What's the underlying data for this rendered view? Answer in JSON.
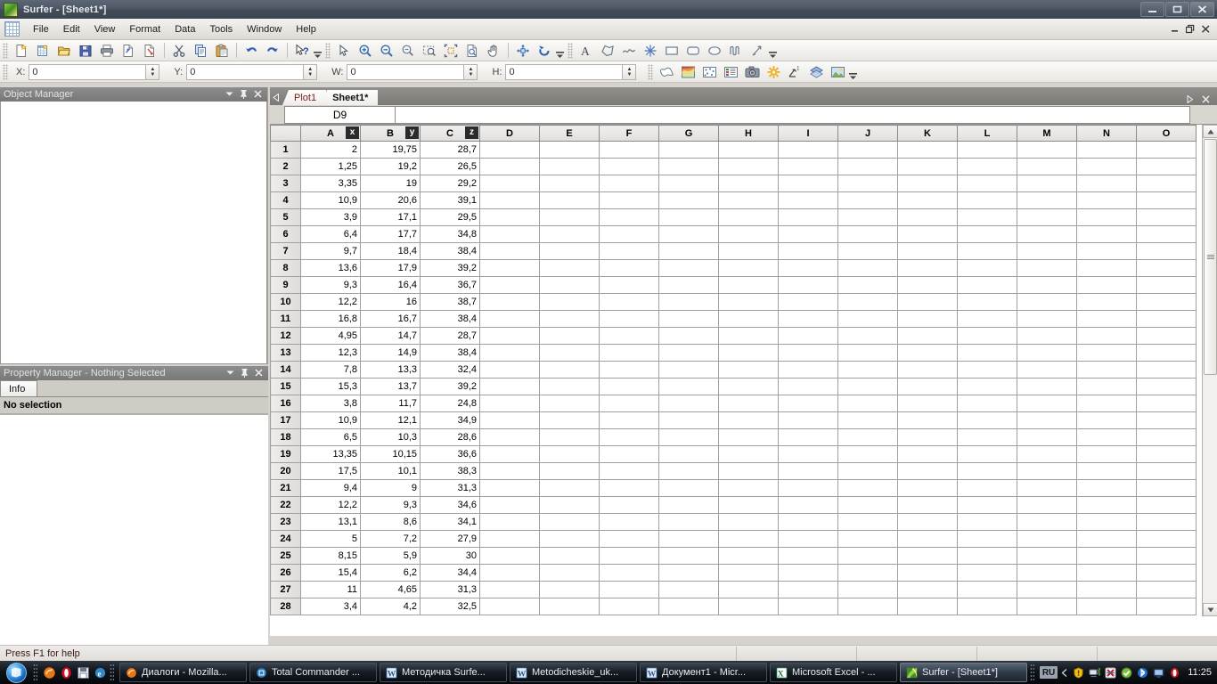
{
  "window": {
    "title": "Surfer - [Sheet1*]",
    "icon": "surfer-logo-icon",
    "minimize": "–",
    "maximize": "❐",
    "close": "✕",
    "mdi_minimize": "–",
    "mdi_restore": "❐",
    "mdi_close": "✕"
  },
  "menu": {
    "items": [
      {
        "label": "File"
      },
      {
        "label": "Edit"
      },
      {
        "label": "View"
      },
      {
        "label": "Format"
      },
      {
        "label": "Data"
      },
      {
        "label": "Tools"
      },
      {
        "label": "Window"
      },
      {
        "label": "Help"
      }
    ]
  },
  "toolbar_standard": {
    "buttons": [
      {
        "name": "new-icon"
      },
      {
        "name": "new-worksheet-icon"
      },
      {
        "name": "open-icon"
      },
      {
        "name": "save-icon"
      },
      {
        "name": "print-icon"
      },
      {
        "name": "export-icon"
      },
      {
        "name": "page-setup-icon"
      },
      {
        "name": "cut-icon"
      },
      {
        "name": "copy-icon"
      },
      {
        "name": "paste-icon"
      },
      {
        "name": "undo-icon"
      },
      {
        "name": "redo-icon"
      },
      {
        "name": "help-pointer-icon"
      }
    ],
    "overflow": "⌄"
  },
  "toolbar_view": {
    "buttons": [
      {
        "name": "select-arrow-icon"
      },
      {
        "name": "zoom-in-icon"
      },
      {
        "name": "zoom-out-icon"
      },
      {
        "name": "zoom-selected-icon"
      },
      {
        "name": "zoom-rectangle-icon"
      },
      {
        "name": "zoom-fit-icon"
      },
      {
        "name": "zoom-page-icon"
      },
      {
        "name": "pan-hand-icon"
      },
      {
        "name": "move-icon"
      },
      {
        "name": "rotate-icon"
      }
    ],
    "overflow": "⌄"
  },
  "toolbar_draw": {
    "buttons": [
      {
        "name": "text-icon"
      },
      {
        "name": "polygon-icon"
      },
      {
        "name": "polyline-icon"
      },
      {
        "name": "symbol-icon"
      },
      {
        "name": "rectangle-icon"
      },
      {
        "name": "rounded-rectangle-icon"
      },
      {
        "name": "ellipse-icon"
      },
      {
        "name": "spline-polyline-icon"
      },
      {
        "name": "reshape-icon"
      }
    ],
    "overflow": "⌄"
  },
  "toolbar_map": {
    "buttons": [
      {
        "name": "base-map-icon"
      },
      {
        "name": "contour-map-icon"
      },
      {
        "name": "post-map-icon"
      },
      {
        "name": "classed-post-map-icon"
      },
      {
        "name": "image-map-icon"
      },
      {
        "name": "shaded-relief-icon"
      },
      {
        "name": "vector-map-icon"
      },
      {
        "name": "wireframe-icon"
      },
      {
        "name": "surface-icon"
      }
    ],
    "overflow": "⌄"
  },
  "coordbar": {
    "fields": [
      {
        "label": "X:",
        "value": "0"
      },
      {
        "label": "Y:",
        "value": "0"
      },
      {
        "label": "W:",
        "value": "0"
      },
      {
        "label": "H:",
        "value": "0"
      }
    ],
    "spin_up": "▲",
    "spin_down": "▼"
  },
  "object_manager": {
    "title": "Object Manager",
    "menu_btn": "▼",
    "pin_btn": "📌",
    "close_btn": "✕"
  },
  "property_manager": {
    "title": "Property Manager - Nothing Selected",
    "menu_btn": "▼",
    "pin_btn": "📌",
    "close_btn": "✕",
    "tabs": [
      {
        "label": "Info"
      }
    ],
    "selection_text": "No selection"
  },
  "sheet_window": {
    "nav_left": "◁",
    "tabs": [
      {
        "label": "Plot1",
        "active": false
      },
      {
        "label": "Sheet1*",
        "active": true
      }
    ],
    "restore_btn": "▷",
    "close_btn": "✕",
    "namebox": "D9",
    "formula": ""
  },
  "grid": {
    "columns": [
      {
        "letter": "A",
        "badge": "x"
      },
      {
        "letter": "B",
        "badge": "y"
      },
      {
        "letter": "C",
        "badge": "z"
      },
      {
        "letter": "D",
        "badge": ""
      },
      {
        "letter": "E",
        "badge": ""
      },
      {
        "letter": "F",
        "badge": ""
      },
      {
        "letter": "G",
        "badge": ""
      },
      {
        "letter": "H",
        "badge": ""
      },
      {
        "letter": "I",
        "badge": ""
      },
      {
        "letter": "J",
        "badge": ""
      },
      {
        "letter": "K",
        "badge": ""
      },
      {
        "letter": "L",
        "badge": ""
      },
      {
        "letter": "M",
        "badge": ""
      },
      {
        "letter": "N",
        "badge": ""
      },
      {
        "letter": "O",
        "badge": ""
      }
    ],
    "rows": [
      {
        "n": "1",
        "a": "2",
        "b": "19,75",
        "c": "28,7"
      },
      {
        "n": "2",
        "a": "1,25",
        "b": "19,2",
        "c": "26,5"
      },
      {
        "n": "3",
        "a": "3,35",
        "b": "19",
        "c": "29,2"
      },
      {
        "n": "4",
        "a": "10,9",
        "b": "20,6",
        "c": "39,1"
      },
      {
        "n": "5",
        "a": "3,9",
        "b": "17,1",
        "c": "29,5"
      },
      {
        "n": "6",
        "a": "6,4",
        "b": "17,7",
        "c": "34,8"
      },
      {
        "n": "7",
        "a": "9,7",
        "b": "18,4",
        "c": "38,4"
      },
      {
        "n": "8",
        "a": "13,6",
        "b": "17,9",
        "c": "39,2"
      },
      {
        "n": "9",
        "a": "9,3",
        "b": "16,4",
        "c": "36,7"
      },
      {
        "n": "10",
        "a": "12,2",
        "b": "16",
        "c": "38,7"
      },
      {
        "n": "11",
        "a": "16,8",
        "b": "16,7",
        "c": "38,4"
      },
      {
        "n": "12",
        "a": "4,95",
        "b": "14,7",
        "c": "28,7"
      },
      {
        "n": "13",
        "a": "12,3",
        "b": "14,9",
        "c": "38,4"
      },
      {
        "n": "14",
        "a": "7,8",
        "b": "13,3",
        "c": "32,4"
      },
      {
        "n": "15",
        "a": "15,3",
        "b": "13,7",
        "c": "39,2"
      },
      {
        "n": "16",
        "a": "3,8",
        "b": "11,7",
        "c": "24,8"
      },
      {
        "n": "17",
        "a": "10,9",
        "b": "12,1",
        "c": "34,9"
      },
      {
        "n": "18",
        "a": "6,5",
        "b": "10,3",
        "c": "28,6"
      },
      {
        "n": "19",
        "a": "13,35",
        "b": "10,15",
        "c": "36,6"
      },
      {
        "n": "20",
        "a": "17,5",
        "b": "10,1",
        "c": "38,3"
      },
      {
        "n": "21",
        "a": "9,4",
        "b": "9",
        "c": "31,3"
      },
      {
        "n": "22",
        "a": "12,2",
        "b": "9,3",
        "c": "34,6"
      },
      {
        "n": "23",
        "a": "13,1",
        "b": "8,6",
        "c": "34,1"
      },
      {
        "n": "24",
        "a": "5",
        "b": "7,2",
        "c": "27,9"
      },
      {
        "n": "25",
        "a": "8,15",
        "b": "5,9",
        "c": "30"
      },
      {
        "n": "26",
        "a": "15,4",
        "b": "6,2",
        "c": "34,4"
      },
      {
        "n": "27",
        "a": "11",
        "b": "4,65",
        "c": "31,3"
      },
      {
        "n": "28",
        "a": "3,4",
        "b": "4,2",
        "c": "32,5"
      }
    ]
  },
  "scrollbars": {
    "v_up": "▲",
    "v_down": "▼",
    "v_grip": "≡",
    "h_left": "◀",
    "h_right": "▶",
    "h_grip": "⦀"
  },
  "statusbar": {
    "text": "Press F1 for help"
  },
  "taskbar": {
    "start": "start-orb-icon",
    "quicklaunch": [
      {
        "name": "firefox-icon"
      },
      {
        "name": "opera-icon"
      },
      {
        "name": "save-floppy-icon"
      },
      {
        "name": "internet-explorer-icon"
      }
    ],
    "tasks": [
      {
        "label": "Диалоги - Mozilla...",
        "icon": "firefox-icon",
        "active": false
      },
      {
        "label": "Total Commander ...",
        "icon": "total-commander-icon",
        "active": false
      },
      {
        "label": "Методичка Surfe...",
        "icon": "word-icon",
        "active": false
      },
      {
        "label": "Metodicheskie_uk...",
        "icon": "word-icon",
        "active": false
      },
      {
        "label": "Документ1 - Micr...",
        "icon": "word-icon",
        "active": false
      },
      {
        "label": "Microsoft Excel - ...",
        "icon": "excel-icon",
        "active": false
      },
      {
        "label": "Surfer - [Sheet1*]",
        "icon": "surfer-logo-icon",
        "active": true
      }
    ],
    "tray": {
      "language": "RU",
      "expand": "◀",
      "icons": [
        {
          "name": "warning-shield-icon"
        },
        {
          "name": "network-icon"
        },
        {
          "name": "kaspersky-icon"
        },
        {
          "name": "checkmark-green-icon"
        },
        {
          "name": "bluetooth-icon"
        },
        {
          "name": "monitor-icon"
        },
        {
          "name": "opera-tray-icon"
        }
      ],
      "clock": "11:25"
    }
  }
}
